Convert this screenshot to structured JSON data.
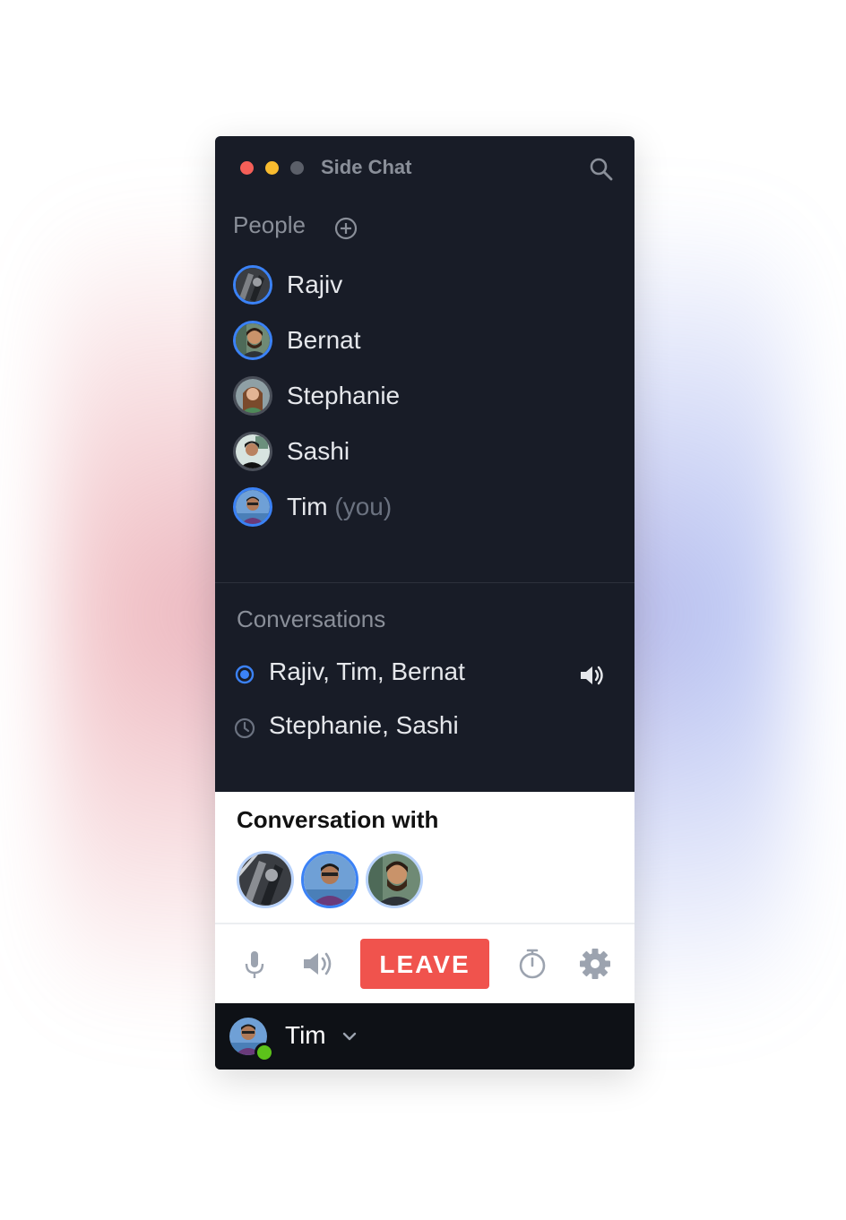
{
  "app": {
    "title": "Side Chat"
  },
  "people": {
    "heading": "People",
    "items": [
      {
        "name": "Rajiv",
        "suffix": ""
      },
      {
        "name": "Bernat",
        "suffix": ""
      },
      {
        "name": "Stephanie",
        "suffix": ""
      },
      {
        "name": "Sashi",
        "suffix": ""
      },
      {
        "name": "Tim",
        "suffix": "(you)"
      }
    ]
  },
  "conversations": {
    "heading": "Conversations",
    "items": [
      {
        "label": "Rajiv, Tim, Bernat",
        "status_icon": "radio-active-icon",
        "audio_icon": "speaker-icon"
      },
      {
        "label": "Stephanie, Sashi",
        "status_icon": "clock-icon"
      }
    ]
  },
  "current_conversation": {
    "title": "Conversation with",
    "participants": [
      "Rajiv",
      "Tim",
      "Bernat"
    ]
  },
  "controls": {
    "leave_label": "LEAVE",
    "icons": [
      "microphone-icon",
      "speaker-icon",
      "timer-icon",
      "gear-icon"
    ]
  },
  "user": {
    "name": "Tim",
    "status": "online"
  },
  "colors": {
    "window_bg": "#181c27",
    "accent_blue": "#3b82f6",
    "leave_red": "#f0534d",
    "online_green": "#5cc21a",
    "text_muted": "#8a8f99"
  }
}
